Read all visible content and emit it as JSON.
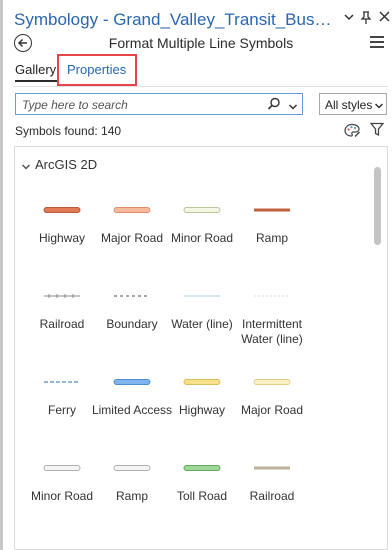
{
  "window": {
    "title": "Symbology - Grand_Valley_Transit_Bus_Rou...",
    "header_title": "Format Multiple Line Symbols"
  },
  "tabs": {
    "gallery_label": "Gallery",
    "properties_label": "Properties"
  },
  "search": {
    "placeholder": "Type here to search",
    "value": "",
    "styles_label": "All styles"
  },
  "symbols_found": "Symbols found: 140",
  "group": {
    "label": "ArcGIS 2D"
  },
  "scroll_fraction": 0.0,
  "symbols": [
    {
      "label": "Highway",
      "swatch_color": "#e07a55",
      "swatch_border": "#b8583a",
      "style": "thick"
    },
    {
      "label": "Major Road",
      "swatch_color": "#f7b89b",
      "swatch_border": "#e08c6b",
      "style": "thick"
    },
    {
      "label": "Minor Road",
      "swatch_color": "#f4f6e4",
      "swatch_border": "#b9c79c",
      "style": "thick"
    },
    {
      "label": "Ramp",
      "swatch_color": "#c0603f",
      "swatch_border": "#a04a2e",
      "style": "thin-bar"
    },
    {
      "label": "Railroad",
      "swatch_color": "#8c8c8c",
      "swatch_border": "#8c8c8c",
      "style": "railroad"
    },
    {
      "label": "Boundary",
      "swatch_color": "#8a8a8a",
      "swatch_border": "#8a8a8a",
      "style": "dashed"
    },
    {
      "label": "Water (line)",
      "swatch_color": "#bcd9ee",
      "swatch_border": "#bcd9ee",
      "style": "hairline"
    },
    {
      "label": "Intermittent Water (line)",
      "swatch_color": "#d0e3f1",
      "swatch_border": "#d0e3f1",
      "style": "dotted"
    },
    {
      "label": "Ferry",
      "swatch_color": "#6da0cf",
      "swatch_border": "#6da0cf",
      "style": "dashed-blue"
    },
    {
      "label": "Limited Access",
      "swatch_color": "#7fb4ee",
      "swatch_border": "#4f8fd6",
      "style": "thick"
    },
    {
      "label": "Highway",
      "swatch_color": "#f7e08a",
      "swatch_border": "#d9bf5a",
      "style": "thick"
    },
    {
      "label": "Major Road",
      "swatch_color": "#fbf0c4",
      "swatch_border": "#e0cf86",
      "style": "thick"
    },
    {
      "label": "Minor Road",
      "swatch_color": "#f4f4f4",
      "swatch_border": "#b0b0b0",
      "style": "thick"
    },
    {
      "label": "Ramp",
      "swatch_color": "#f4f4f4",
      "swatch_border": "#b0b0b0",
      "style": "thick"
    },
    {
      "label": "Toll Road",
      "swatch_color": "#9fd69a",
      "swatch_border": "#5fa85a",
      "style": "thick"
    },
    {
      "label": "Railroad",
      "swatch_color": "#b9b19a",
      "swatch_border": "#9b927a",
      "style": "thin-bar"
    }
  ]
}
